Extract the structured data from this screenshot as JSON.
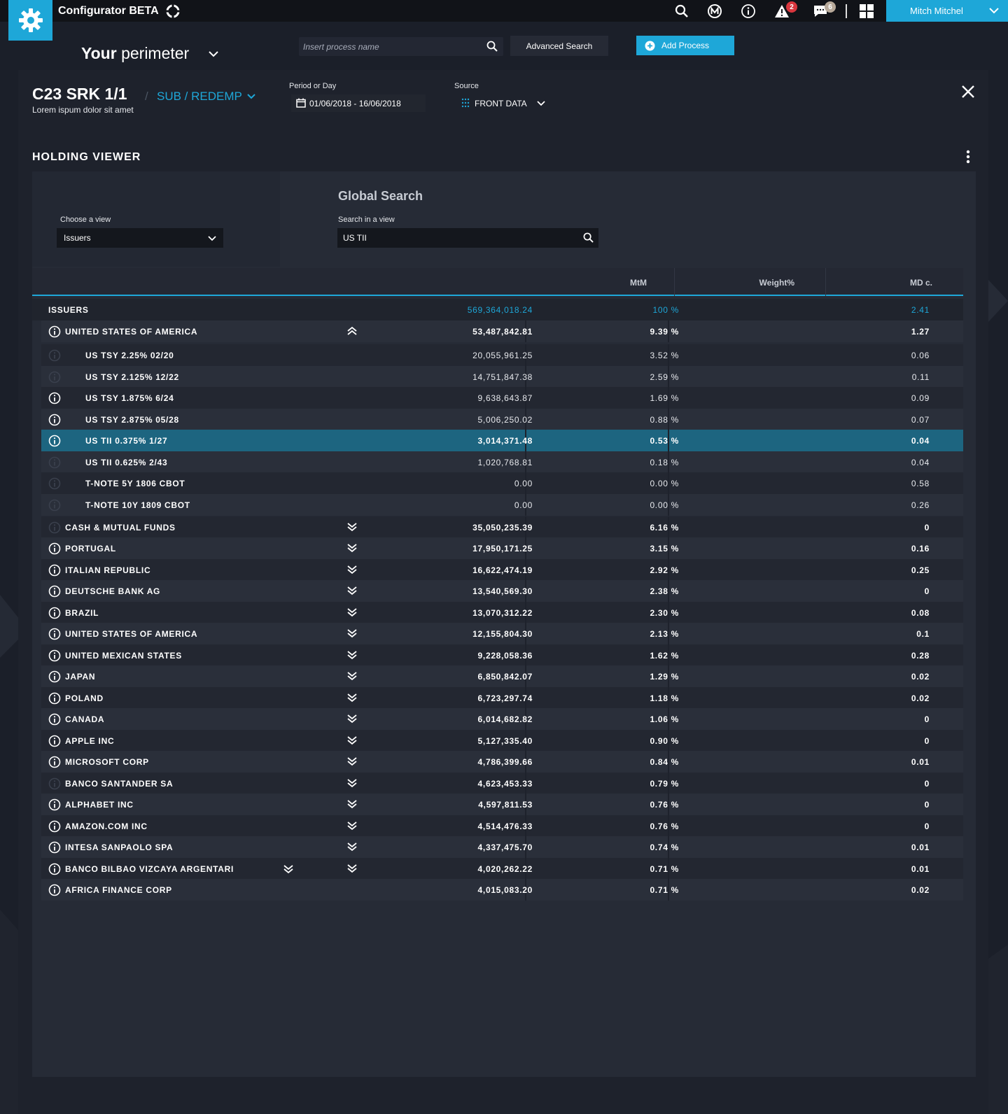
{
  "app": {
    "title": "Configurator BETA",
    "user_name": "Mitch Mitchel",
    "alerts_count": "2",
    "messages_count": "6",
    "accent_color": "#1ea7d8"
  },
  "header": {
    "perimeter_bold": "Your",
    "perimeter_rest": " perimeter",
    "search_placeholder": "Insert process name",
    "advanced_search": "Advanced Search",
    "add_process": "Add Process"
  },
  "process": {
    "title": "C23 SRK 1/1",
    "subtitle": "Lorem ispum dolor sit amet",
    "separator": "/",
    "type": "SUB / REDEMP",
    "period_label": "Period or Day",
    "period_value": "01/06/2018 - 16/06/2018",
    "source_label": "Source",
    "source_value": "FRONT DATA"
  },
  "viewer": {
    "title": "HOLDING VIEWER",
    "global_search_title": "Global Search",
    "choose_view_label": "Choose a view",
    "choose_view_value": "Issuers",
    "search_in_view_label": "Search in a view",
    "search_in_view_value": "US TII",
    "columns": [
      "MtM",
      "Weight%",
      "MD c."
    ],
    "total": {
      "label": "ISSUERS",
      "mtm": "569,364,018.24",
      "weight": "100 %",
      "md": "2.41"
    },
    "rows": [
      {
        "name": "UNITED STATES OF AMERICA",
        "mtm": "53,487,842.81",
        "weight": "9.39 %",
        "md": "1.27",
        "kind": "group",
        "expanded": true,
        "info": true
      },
      {
        "name": "US TSY 2.25% 02/20",
        "mtm": "20,055,961.25",
        "weight": "3.52 %",
        "md": "0.06",
        "kind": "child",
        "info": false
      },
      {
        "name": "US TSY 2.125% 12/22",
        "mtm": "14,751,847.38",
        "weight": "2.59 %",
        "md": "0.11",
        "kind": "child",
        "info": false
      },
      {
        "name": "US TSY 1.875% 6/24",
        "mtm": "9,638,643.87",
        "weight": "1.69 %",
        "md": "0.09",
        "kind": "child",
        "info": true
      },
      {
        "name": "US TSY 2.875% 05/28",
        "mtm": "5,006,250.02",
        "weight": "0.88 %",
        "md": "0.07",
        "kind": "child",
        "info": true
      },
      {
        "name": "US TII 0.375% 1/27",
        "mtm": "3,014,371.48",
        "weight": "0.53 %",
        "md": "0.04",
        "kind": "child",
        "selected": true,
        "info": true
      },
      {
        "name": "US TII 0.625% 2/43",
        "mtm": "1,020,768.81",
        "weight": "0.18 %",
        "md": "0.04",
        "kind": "child",
        "info": false
      },
      {
        "name": "T-NOTE 5Y 1806 CBOT",
        "mtm": "0.00",
        "weight": "0.00 %",
        "md": "0.58",
        "kind": "child",
        "info": false
      },
      {
        "name": "T-NOTE 10Y 1809 CBOT",
        "mtm": "0.00",
        "weight": "0.00 %",
        "md": "0.26",
        "kind": "child",
        "info": false
      },
      {
        "name": "CASH & MUTUAL FUNDS",
        "mtm": "35,050,235.39",
        "weight": "6.16 %",
        "md": "0",
        "kind": "group",
        "info": false
      },
      {
        "name": "PORTUGAL",
        "mtm": "17,950,171.25",
        "weight": "3.15 %",
        "md": "0.16",
        "kind": "group",
        "info": true
      },
      {
        "name": "ITALIAN REPUBLIC",
        "mtm": "16,622,474.19",
        "weight": "2.92 %",
        "md": "0.25",
        "kind": "group",
        "info": true
      },
      {
        "name": "DEUTSCHE BANK AG",
        "mtm": "13,540,569.30",
        "weight": "2.38 %",
        "md": "0",
        "kind": "group",
        "info": true
      },
      {
        "name": "BRAZIL",
        "mtm": "13,070,312.22",
        "weight": "2.30 %",
        "md": "0.08",
        "kind": "group",
        "info": true
      },
      {
        "name": "UNITED STATES OF AMERICA",
        "mtm": "12,155,804.30",
        "weight": "2.13 %",
        "md": "0.1",
        "kind": "group",
        "info": true
      },
      {
        "name": "UNITED MEXICAN STATES",
        "mtm": "9,228,058.36",
        "weight": "1.62 %",
        "md": "0.28",
        "kind": "group",
        "info": true
      },
      {
        "name": "JAPAN",
        "mtm": "6,850,842.07",
        "weight": "1.29 %",
        "md": "0.02",
        "kind": "group",
        "info": true
      },
      {
        "name": "POLAND",
        "mtm": "6,723,297.74",
        "weight": "1.18 %",
        "md": "0.02",
        "kind": "group",
        "info": true
      },
      {
        "name": "CANADA",
        "mtm": "6,014,682.82",
        "weight": "1.06 %",
        "md": "0",
        "kind": "group",
        "info": true
      },
      {
        "name": "APPLE INC",
        "mtm": "5,127,335.40",
        "weight": "0.90 %",
        "md": "0",
        "kind": "group",
        "info": true
      },
      {
        "name": "MICROSOFT CORP",
        "mtm": "4,786,399.66",
        "weight": "0.84 %",
        "md": "0.01",
        "kind": "group",
        "info": true
      },
      {
        "name": "BANCO SANTANDER SA",
        "mtm": "4,623,453.33",
        "weight": "0.79 %",
        "md": "0",
        "kind": "group",
        "info": false
      },
      {
        "name": "ALPHABET INC",
        "mtm": "4,597,811.53",
        "weight": "0.76 %",
        "md": "0",
        "kind": "group",
        "info": true
      },
      {
        "name": "AMAZON.COM INC",
        "mtm": "4,514,476.33",
        "weight": "0.76 %",
        "md": "0",
        "kind": "group",
        "info": true
      },
      {
        "name": "INTESA SANPAOLO SPA",
        "mtm": "4,337,475.70",
        "weight": "0.74 %",
        "md": "0.01",
        "kind": "group",
        "info": true
      },
      {
        "name": "BANCO BILBAO VIZCAYA ARGENTARI",
        "mtm": "4,020,262.22",
        "weight": "0.71 %",
        "md": "0.01",
        "kind": "group",
        "info": true,
        "double_expander": true
      },
      {
        "name": "AFRICA FINANCE CORP",
        "mtm": "4,015,083.20",
        "weight": "0.71 %",
        "md": "0.02",
        "kind": "group",
        "info": true,
        "no_expander": true
      }
    ]
  }
}
